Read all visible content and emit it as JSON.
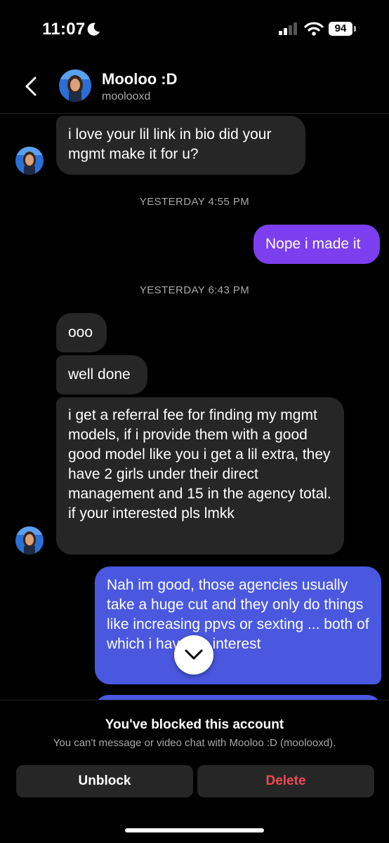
{
  "status_bar": {
    "time": "11:07",
    "battery": "94"
  },
  "header": {
    "name": "Mooloo :D",
    "handle": "moolooxd"
  },
  "messages": {
    "m1": "i love your lil link in bio did your mgmt make it for u?",
    "stamp1": "YESTERDAY 4:55 PM",
    "m2": "Nope i made it",
    "stamp2": "YESTERDAY 6:43 PM",
    "m3": "ooo",
    "m4": "well done",
    "m5": "i get a referral fee for finding my mgmt models, if i provide them with a good good model like you i get a lil extra, they have 2 girls under their direct management and 15 in the agency total. if your interested pls lmkk",
    "m6": "Nah im good, those agencies usually take a huge cut and they only do things like increasing ppvs or sexting ... both of which i have no interest"
  },
  "footer": {
    "title": "You've blocked this account",
    "subtitle": "You can't message or video chat with Mooloo :D (moolooxd).",
    "unblock": "Unblock",
    "delete": "Delete"
  },
  "colors": {
    "incoming": "#262626",
    "outgoing_purple": "#7b3ff0",
    "outgoing_blue": "#4a58e0",
    "delete_red": "#ed4956"
  },
  "icons": [
    "moon-icon",
    "signal-icon",
    "wifi-icon",
    "back-chevron-icon",
    "chevron-down-icon"
  ]
}
